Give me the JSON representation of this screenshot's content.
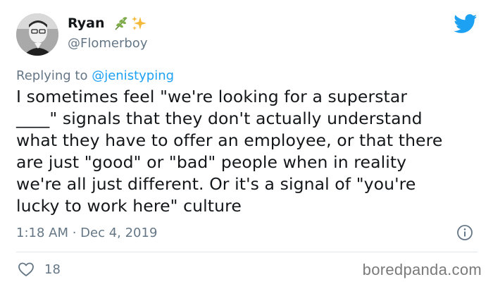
{
  "tweet": {
    "author": {
      "display_name": "Ryan",
      "emojis": [
        "herb",
        "sparkles"
      ],
      "handle": "@Flomerboy"
    },
    "replying_to_prefix": "Replying to ",
    "replying_to_mention": "@jenistyping",
    "lines": [
      "I sometimes feel \"we're looking for a superstar",
      "____\" signals that they don't actually understand",
      "what they have to offer an employee, or that there",
      "are just \"good\" or \"bad\" people when in reality",
      "we're all just different. Or it's a signal of \"you're",
      "lucky to work here\" culture"
    ],
    "timestamp": "1:18 AM · Dec 4, 2019",
    "likes": "18"
  },
  "watermark": "boredpanda.com",
  "colors": {
    "brand": "#1da1f2",
    "text": "#14171a",
    "secondary": "#657786",
    "divider": "#e1e8ed"
  },
  "icons": [
    "twitter-bird-icon",
    "info-icon",
    "heart-icon"
  ]
}
